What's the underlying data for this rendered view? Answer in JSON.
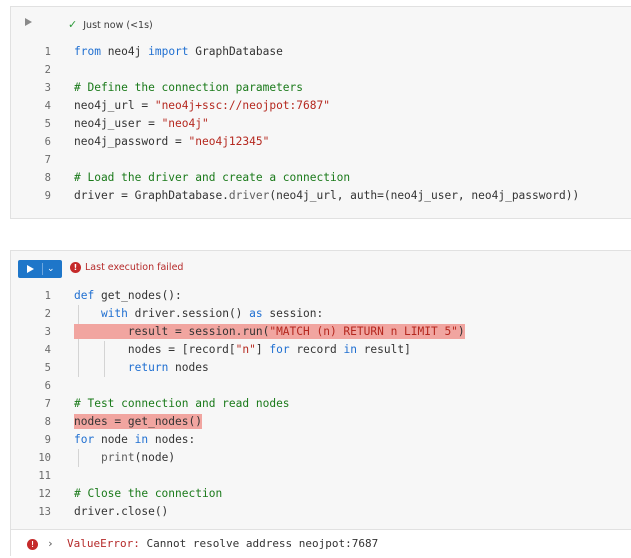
{
  "cell1": {
    "status": "Just now (<1s)",
    "lines": [
      {
        "n": "1",
        "text": "from neo4j import GraphDatabase"
      },
      {
        "n": "2",
        "text": ""
      },
      {
        "n": "3",
        "text": "# Define the connection parameters"
      },
      {
        "n": "4",
        "text": "neo4j_url = \"neo4j+ssc://neojpot:7687\""
      },
      {
        "n": "5",
        "text": "neo4j_user = \"neo4j\""
      },
      {
        "n": "6",
        "text": "neo4j_password = \"neo4j12345\""
      },
      {
        "n": "7",
        "text": ""
      },
      {
        "n": "8",
        "text": "# Load the driver and create a connection"
      },
      {
        "n": "9",
        "text": "driver = GraphDatabase.driver(neo4j_url, auth=(neo4j_user, neo4j_password))"
      }
    ]
  },
  "cell2": {
    "status": "Last execution failed",
    "lines": [
      {
        "n": "1",
        "text": "def get_nodes():"
      },
      {
        "n": "2",
        "text": "with driver.session() as session:"
      },
      {
        "n": "3",
        "text": "result = session.run(\"MATCH (n) RETURN n LIMIT 5\")"
      },
      {
        "n": "4",
        "text": "nodes = [record[\"n\"] for record in result]"
      },
      {
        "n": "5",
        "text": "return nodes"
      },
      {
        "n": "6",
        "text": ""
      },
      {
        "n": "7",
        "text": "# Test connection and read nodes"
      },
      {
        "n": "8",
        "text": "nodes = get_nodes()"
      },
      {
        "n": "9",
        "text": "for node in nodes:"
      },
      {
        "n": "10",
        "text": "print(node)"
      },
      {
        "n": "11",
        "text": ""
      },
      {
        "n": "12",
        "text": "# Close the connection"
      },
      {
        "n": "13",
        "text": "driver.close()"
      }
    ],
    "error": {
      "type": "ValueError:",
      "message": "Cannot resolve address neojpot:7687"
    }
  },
  "colors": {
    "accent": "#1e76c9",
    "error": "#c52a2a",
    "success": "#2d9a3a",
    "highlight": "#f1a5a0"
  },
  "icons": {
    "success": "checkmark-icon",
    "error": "error-circle-icon",
    "run": "play-icon",
    "expand": "chevron-right-icon"
  }
}
